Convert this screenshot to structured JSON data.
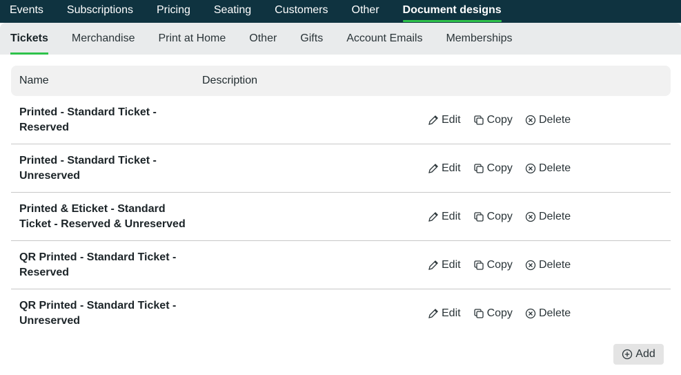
{
  "top_nav": {
    "items": [
      "Events",
      "Subscriptions",
      "Pricing",
      "Seating",
      "Customers",
      "Other",
      "Document designs"
    ],
    "active_index": 6
  },
  "sub_nav": {
    "items": [
      "Tickets",
      "Merchandise",
      "Print at Home",
      "Other",
      "Gifts",
      "Account Emails",
      "Memberships"
    ],
    "active_index": 0
  },
  "table": {
    "columns": {
      "name": "Name",
      "description": "Description"
    },
    "rows": [
      {
        "name": "Printed - Standard Ticket - Reserved",
        "description": ""
      },
      {
        "name": "Printed - Standard Ticket - Unreserved",
        "description": ""
      },
      {
        "name": "Printed & Eticket - Standard Ticket - Reserved & Unreserved",
        "description": ""
      },
      {
        "name": "QR Printed - Standard Ticket - Reserved",
        "description": ""
      },
      {
        "name": "QR Printed - Standard Ticket - Unreserved",
        "description": ""
      }
    ],
    "actions": {
      "edit": {
        "label": "Edit",
        "icon": "pencil-icon"
      },
      "copy": {
        "label": "Copy",
        "icon": "copy-icon"
      },
      "delete": {
        "label": "Delete",
        "icon": "circle-x-icon"
      }
    }
  },
  "add_button": {
    "label": "Add",
    "icon": "plus-circle-icon"
  },
  "colors": {
    "top_nav_bg": "#0f3340",
    "accent_green": "#2ec24a",
    "sub_nav_bg": "#e9ebec",
    "header_bg": "#f1f1f1",
    "button_bg": "#e4e4e4"
  }
}
